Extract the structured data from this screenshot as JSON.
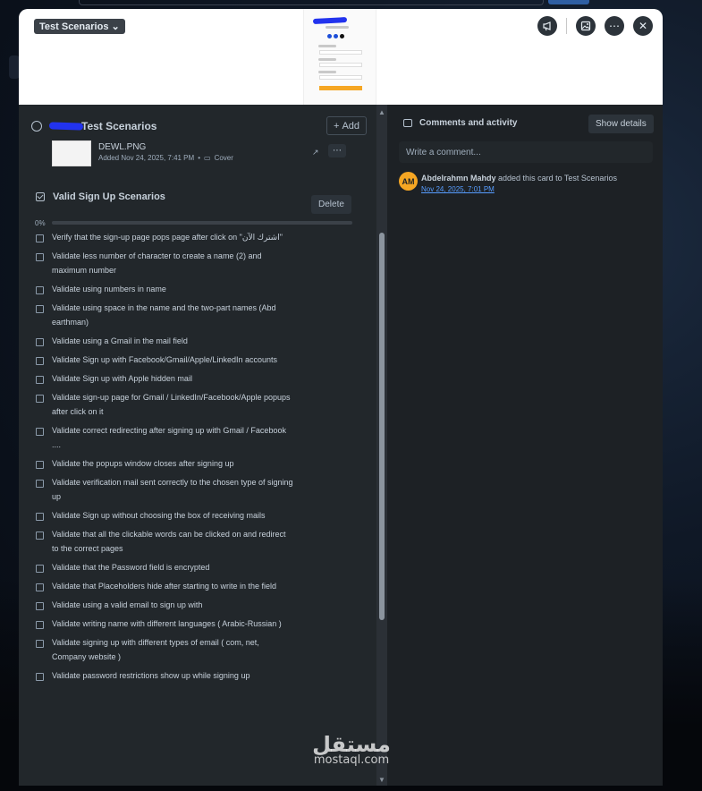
{
  "cover": {
    "list_badge": "Test Scenarios",
    "actions": [
      "megaphone-icon",
      "image-icon",
      "more-icon",
      "close-icon"
    ]
  },
  "card": {
    "title": "Test Scenarios",
    "add_label": "Add",
    "attachment": {
      "name": "DEWL.PNG",
      "added": "Added Nov 24, 2025, 7:41 PM",
      "cover_label": "Cover"
    }
  },
  "checklist": {
    "title": "Valid Sign Up Scenarios",
    "delete_label": "Delete",
    "progress_label": "0%",
    "progress_fraction": 0,
    "items": [
      "Verify that the sign-up page pops page after click on \"اشترك الآن\"",
      "Validate less number of character to create a name (2) and maximum number",
      "Validate using numbers in name",
      "Validate using space in the name and the two-part names (Abd earthman)",
      "Validate using a Gmail in the mail field",
      "Validate Sign up with Facebook/Gmail/Apple/LinkedIn accounts",
      "Validate Sign up with Apple hidden mail",
      "Validate sign-up page  for Gmail / LinkedIn/Facebook/Apple popups after click on it",
      "Validate correct redirecting after signing up with Gmail / Facebook ....",
      "Validate the popups window closes after signing up",
      "Validate verification mail sent correctly to the chosen type of signing up",
      "Validate Sign up without choosing the box of receiving mails",
      "Validate that all the clickable words can be clicked on and redirect to the correct pages",
      "Validate that the Password field is encrypted",
      "Validate that Placeholders hide after starting to write in the field",
      "Validate using a valid email to sign up with",
      "Validate writing name with different languages ( Arabic-Russian )",
      "Validate signing up with different types of email ( com, net, Company website )",
      "Validate password restrictions show up while signing up"
    ]
  },
  "activity_panel": {
    "title": "Comments and activity",
    "show_details_label": "Show details",
    "comment_placeholder": "Write a comment...",
    "entries": [
      {
        "avatar_initials": "AM",
        "user": "Abdelrahmn Mahdy",
        "action": "added this card to Test Scenarios",
        "time": "Nov 24, 2025, 7:01 PM"
      }
    ]
  },
  "watermark": {
    "arabic": "مستقل",
    "latin": "mostaql.com"
  },
  "colors": {
    "modal_bg": "#22272b",
    "panel_bg": "#1d2125",
    "avatar": "#f5a623",
    "link": "#579dff"
  }
}
